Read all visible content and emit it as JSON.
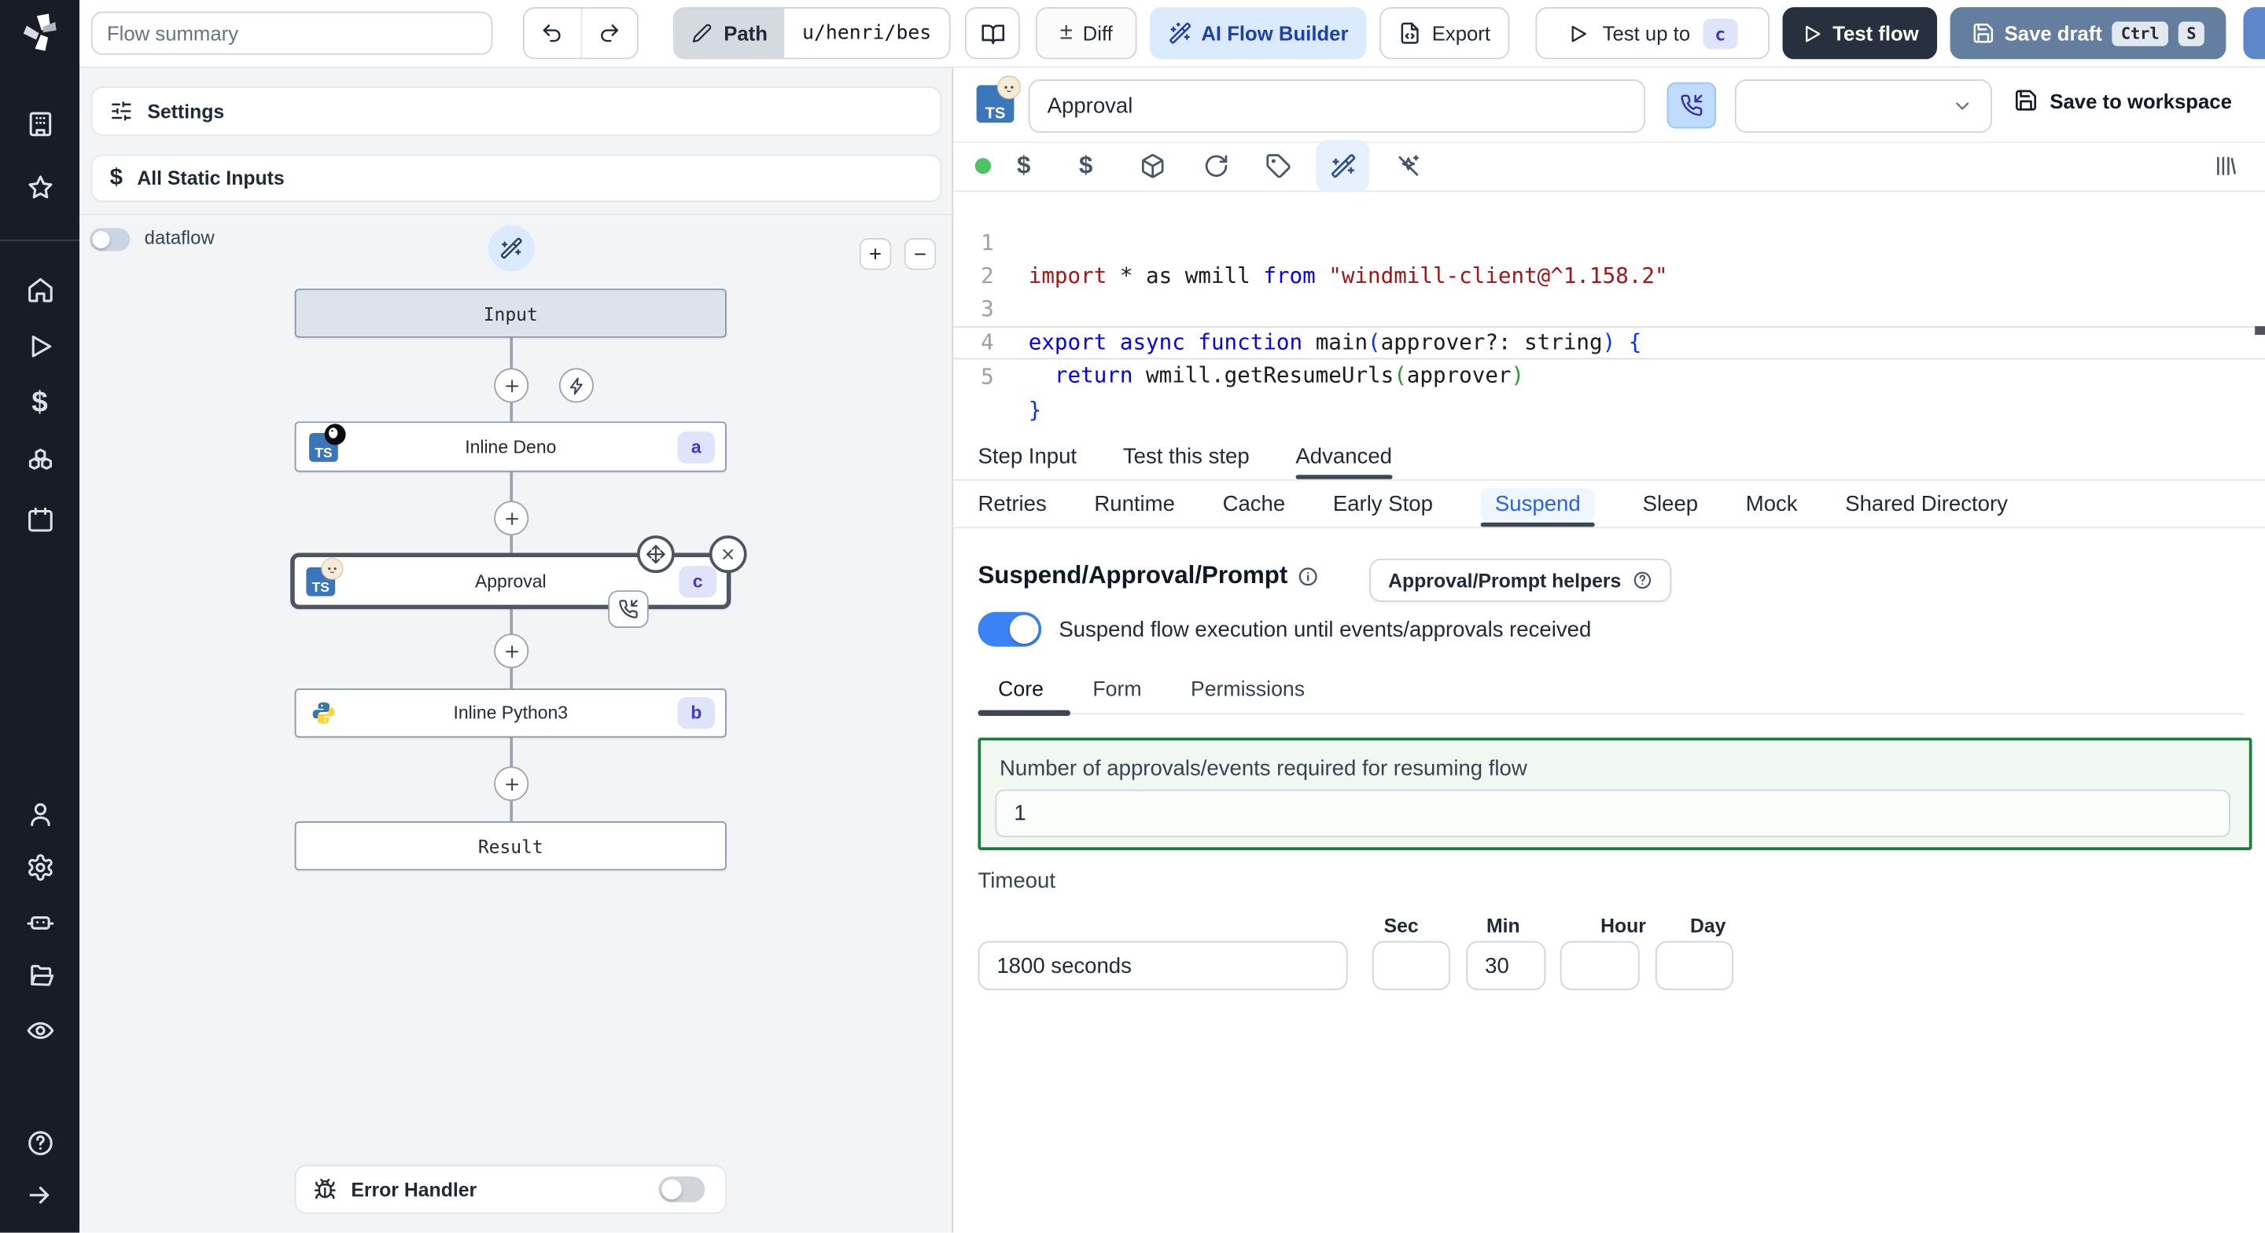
{
  "topbar": {
    "flow_summary_placeholder": "Flow summary",
    "path_label": "Path",
    "path_value": "u/henri/bes",
    "diff_label": "Diff",
    "plusminus": "±",
    "ai_flow_builder_label": "AI Flow Builder",
    "export_label": "Export",
    "test_up_to_label": "Test up to",
    "test_up_to_badge": "c",
    "test_flow_label": "Test flow",
    "save_draft_label": "Save draft",
    "kbd_ctrl": "Ctrl",
    "kbd_s": "S"
  },
  "left_panel": {
    "settings_label": "Settings",
    "static_inputs_label": "All Static Inputs",
    "dataflow_label": "dataflow",
    "zoom_in": "+",
    "zoom_out": "−",
    "nodes": {
      "input": {
        "label": "Input"
      },
      "deno": {
        "label": "Inline Deno",
        "badge": "a",
        "lang": "TS"
      },
      "approval": {
        "label": "Approval",
        "badge": "c",
        "lang": "TS"
      },
      "python": {
        "label": "Inline Python3",
        "badge": "b"
      },
      "result": {
        "label": "Result"
      }
    },
    "error_handler_label": "Error Handler"
  },
  "step": {
    "title_value": "Approval",
    "lang_badge": "TS",
    "save_to_workspace_label": "Save to workspace",
    "code": {
      "numbers": [
        "1",
        "2",
        "3",
        "4",
        "5"
      ],
      "l1": {
        "kw_import": "import",
        "plain": " * as wmill ",
        "kw_from": "from",
        "str": " \"windmill-client@^1.158.2\""
      },
      "l3": {
        "kw": "export async function",
        "fn": " main",
        "p1": "(",
        "params": "approver?: string",
        "p2": ")",
        "brace": " {"
      },
      "l4": {
        "indent": "  ",
        "kw": "return",
        "id": " wmill.getResumeUrls",
        "p1": "(",
        "arg": "approver",
        "p2": ")"
      },
      "l5": {
        "brace": "}"
      }
    },
    "tabs": [
      {
        "label": "Step Input"
      },
      {
        "label": "Test this step"
      },
      {
        "label": "Advanced"
      }
    ],
    "subtabs": [
      {
        "label": "Retries"
      },
      {
        "label": "Runtime"
      },
      {
        "label": "Cache"
      },
      {
        "label": "Early Stop"
      },
      {
        "label": "Suspend"
      },
      {
        "label": "Sleep"
      },
      {
        "label": "Mock"
      },
      {
        "label": "Shared Directory"
      }
    ],
    "suspend": {
      "heading": "Suspend/Approval/Prompt",
      "helpers_button_label": "Approval/Prompt helpers",
      "toggle_label": "Suspend flow execution until events/approvals received",
      "tabs": [
        {
          "label": "Core"
        },
        {
          "label": "Form"
        },
        {
          "label": "Permissions"
        }
      ],
      "approvals_label": "Number of approvals/events required for resuming flow",
      "approvals_value": "1",
      "timeout_label": "Timeout",
      "timeout_value": "1800 seconds",
      "units": [
        {
          "label": "Sec",
          "value": ""
        },
        {
          "label": "Min",
          "value": "30"
        },
        {
          "label": "Hour",
          "value": ""
        },
        {
          "label": "Day",
          "value": ""
        }
      ]
    }
  },
  "colors": {
    "accent_blue": "#3b82f6",
    "suspend_tab_text": "#2563eb",
    "ai_button_bg": "#dbeafe",
    "ai_button_text": "#1e40af",
    "test_flow_bg": "#28303f",
    "save_draft_bg": "#637e9f",
    "badge_bg": "#dfe4fb",
    "badge_text": "#4338ca",
    "approvals_box_border": "#15803d",
    "status_dot": "#4cc366",
    "sidebar_bg": "#181c24"
  }
}
